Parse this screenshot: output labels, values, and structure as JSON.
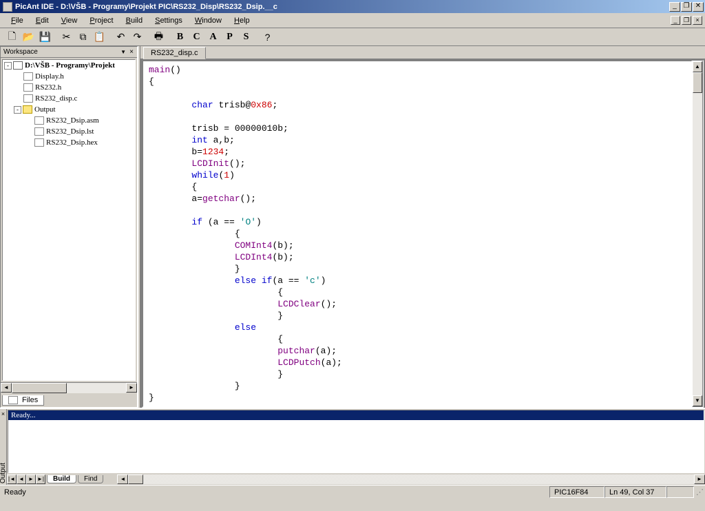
{
  "titlebar": {
    "title": "PicAnt IDE - D:\\VŠB - Programy\\Projekt PIC\\RS232_Disp\\RS232_Dsip.__c"
  },
  "menu": {
    "file": "File",
    "edit": "Edit",
    "view": "View",
    "project": "Project",
    "build": "Build",
    "settings": "Settings",
    "window": "Window",
    "help": "Help"
  },
  "workspace": {
    "title": "Workspace",
    "root": "D:\\VŠB - Programy\\Projekt",
    "items": [
      "Display.h",
      "RS232.h",
      "RS232_disp.c"
    ],
    "output_folder": "Output",
    "output_items": [
      "RS232_Dsip.asm",
      "RS232_Dsip.lst",
      "RS232_Dsip.hex"
    ],
    "tab": "Files"
  },
  "editor": {
    "tab": "RS232_disp.c"
  },
  "code": {
    "l1a": "main",
    "l1b": "()",
    "l2": "{",
    "l3": "",
    "l4a": "        ",
    "l4b": "char",
    "l4c": " trisb@",
    "l4d": "0x86",
    "l4e": ";",
    "l5": "",
    "l6": "        trisb = 00000010b;",
    "l7a": "        ",
    "l7b": "int",
    "l7c": " a,b;",
    "l8a": "        b=",
    "l8b": "1234",
    "l8c": ";",
    "l9a": "        ",
    "l9b": "LCDInit",
    "l9c": "();",
    "l10a": "        ",
    "l10b": "while",
    "l10c": "(",
    "l10d": "1",
    "l10e": ")",
    "l11": "        {",
    "l12a": "        a=",
    "l12b": "getchar",
    "l12c": "();",
    "l13": "",
    "l14a": "        ",
    "l14b": "if",
    "l14c": " (a == ",
    "l14d": "'O'",
    "l14e": ")",
    "l15": "                {",
    "l16a": "                ",
    "l16b": "COMInt4",
    "l16c": "(b);",
    "l17a": "                ",
    "l17b": "LCDInt4",
    "l17c": "(b);",
    "l18": "                }",
    "l19a": "                ",
    "l19b": "else if",
    "l19c": "(a == ",
    "l19d": "'c'",
    "l19e": ")",
    "l20": "                        {",
    "l21a": "                        ",
    "l21b": "LCDClear",
    "l21c": "();",
    "l22": "                        }",
    "l23a": "                ",
    "l23b": "else",
    "l24": "                        {",
    "l25a": "                        ",
    "l25b": "putchar",
    "l25c": "(a);",
    "l26a": "                        ",
    "l26b": "LCDPutch",
    "l26c": "(a);",
    "l27": "                        }",
    "l28": "                }",
    "l29": "}"
  },
  "output": {
    "label": "Output",
    "ready": "Ready...",
    "tab_build": "Build",
    "tab_find": "Find"
  },
  "status": {
    "ready": "Ready",
    "device": "PIC16F84",
    "pos": "Ln 49, Col 37"
  }
}
